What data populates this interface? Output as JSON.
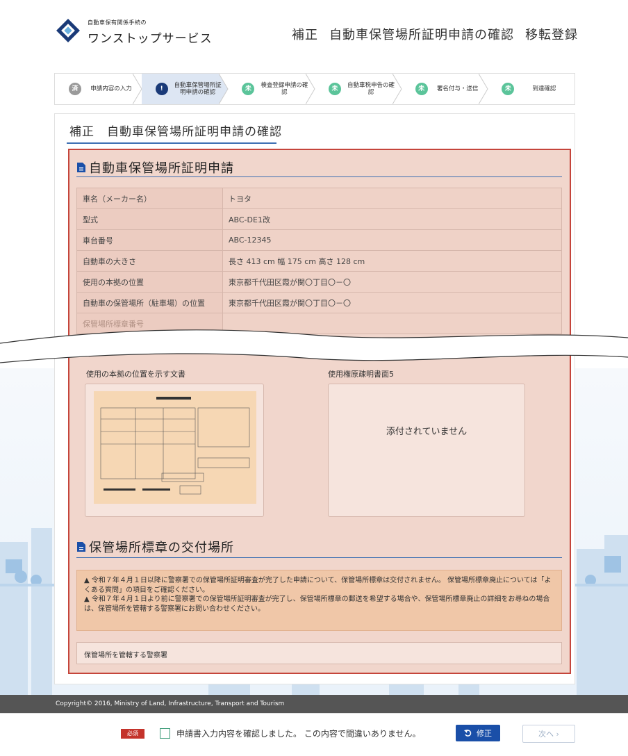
{
  "header": {
    "logo_small": "自動車保有関係手続の",
    "logo_big": "ワンストップサービス",
    "title_parts": [
      "補正",
      "自動車保管場所証明申請の確認",
      "移転登録"
    ]
  },
  "steps": [
    {
      "icon": "済",
      "label": "申請内容の入力",
      "state": "done"
    },
    {
      "icon": "!",
      "label": "自動車保管場所証明申請の確認",
      "state": "current"
    },
    {
      "icon": "未",
      "label": "検査登録申請の確認",
      "state": "todo"
    },
    {
      "icon": "未",
      "label": "自動車税申告の確認",
      "state": "todo"
    },
    {
      "icon": "未",
      "label": "署名付与・送信",
      "state": "todo"
    },
    {
      "icon": "未",
      "label": "到達確認",
      "state": "todo"
    }
  ],
  "card": {
    "title": "補正　自動車保管場所証明申請の確認"
  },
  "section1": {
    "title": "自動車保管場所証明申請",
    "rows": [
      {
        "k": "車名（メーカー名）",
        "v": "トヨタ"
      },
      {
        "k": "型式",
        "v": "ABC-DE1改"
      },
      {
        "k": "車台番号",
        "v": "ABC-12345"
      },
      {
        "k": "自動車の大きさ",
        "v": "長さ 413 cm  幅 175 cm  高さ 128 cm"
      },
      {
        "k": "使用の本拠の位置",
        "v": "東京都千代田区霞が関〇丁目〇－〇"
      },
      {
        "k": "自動車の保管場所（駐車場）の位置",
        "v": "東京都千代田区霞が関〇丁目〇－〇"
      },
      {
        "k": "保管場所標章番号",
        "v": ""
      }
    ]
  },
  "attachments": {
    "left_label": "使用の本拠の位置を示す文書",
    "right_label": "使用権原疎明書面5",
    "right_empty": "添付されていません"
  },
  "section2": {
    "title": "保管場所標章の交付場所",
    "notice": [
      "▲ 令和７年４月１日以降に警察署での保管場所証明審査が完了した申請について、保管場所標章は交付されません。 保管場所標章廃止については「よくある質問」の項目をご確認ください。",
      "▲ 令和７年４月１日より前に警察署での保管場所証明審査が完了し、保管場所標章の郵送を希望する場合や、保管場所標章廃止の詳細をお尋ねの場合は、保管場所を管轄する警察署にお問い合わせください。"
    ],
    "police_label": "保管場所を管轄する警察署"
  },
  "footer": {
    "copyright": "Copyright© 2016, Ministry of Land, Infrastructure, Transport and Tourism",
    "required": "必須",
    "confirm_label": "申請書入力内容を確認しました。 この内容で間違いありません。",
    "edit_button": "修正",
    "next_button": "次へ ›"
  },
  "colors": {
    "accent": "#1a4fa8",
    "todo": "#5bc49a",
    "warning_border": "#c5453b"
  }
}
